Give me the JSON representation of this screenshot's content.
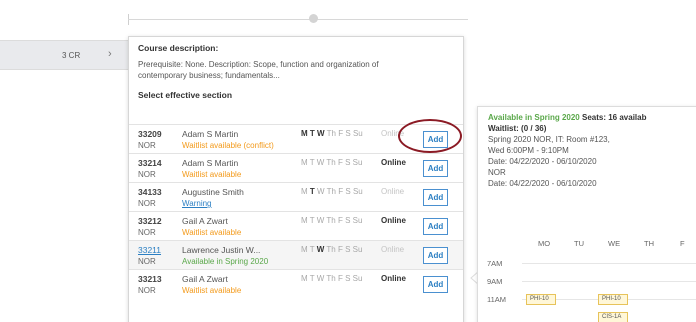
{
  "left_row": {
    "credits": "3 CR",
    "chevron": "›"
  },
  "course": {
    "desc_title": "Course description:",
    "desc_text": "Prerequisite: None. Description: Scope, function and organization of contemporary business; fundamentals...",
    "select_label": "Select effective section"
  },
  "sections": [
    {
      "number": "33209",
      "location": "NOR",
      "instructor": "Adam S Martin",
      "status": "Waitlist available (conflict)",
      "status_color": "#f39a1b",
      "days_active": [
        "M",
        "T",
        "W"
      ],
      "mode": "Online",
      "mode_active": false,
      "add_label": "Add"
    },
    {
      "number": "33214",
      "location": "NOR",
      "instructor": "Adam S Martin",
      "status": "Waitlist available",
      "status_color": "#f39a1b",
      "days_active": [],
      "mode": "Online",
      "mode_active": true,
      "add_label": "Add"
    },
    {
      "number": "34133",
      "location": "NOR",
      "instructor": "Augustine Smith",
      "status": "Warning",
      "status_color": "#2b7fc3",
      "days_active": [
        "T"
      ],
      "mode": "Online",
      "mode_active": false,
      "add_label": "Add"
    },
    {
      "number": "33212",
      "location": "NOR",
      "instructor": "Gail A Zwart",
      "status": "Waitlist available",
      "status_color": "#f39a1b",
      "days_active": [],
      "mode": "Online",
      "mode_active": true,
      "add_label": "Add"
    },
    {
      "number": "33211",
      "location": "NOR",
      "instructor": "Lawrence Justin W...",
      "status": "Available in Spring 2020",
      "status_color": "#5aa84a",
      "days_active": [
        "W"
      ],
      "mode": "Online",
      "mode_active": false,
      "add_label": "Add"
    },
    {
      "number": "33213",
      "location": "NOR",
      "instructor": "Gail A Zwart",
      "status": "Waitlist available",
      "status_color": "#f39a1b",
      "days_active": [],
      "mode": "Online",
      "mode_active": true,
      "add_label": "Add"
    }
  ],
  "day_letters": [
    "M",
    "T",
    "W",
    "Th",
    "F",
    "S",
    "Su"
  ],
  "detail": {
    "available": "Available in Spring 2020",
    "seats": "Seats: 16 availab",
    "waitlist": "Waitlist: (0 / 36)",
    "line1": "Spring 2020 NOR, IT: Room #123,",
    "line2": "Wed 6:00PM - 9:10PM",
    "line3": "Date: 04/22/2020 - 06/10/2020",
    "line4": "NOR",
    "line5": "Date: 04/22/2020 - 06/10/2020"
  },
  "calendar": {
    "days": [
      "MO",
      "TU",
      "WE",
      "TH",
      "F"
    ],
    "times": [
      "7AM",
      "9AM",
      "11AM"
    ],
    "blocks": [
      "PHI-10",
      "PHI-10",
      "PHI-10",
      "CIS-1A"
    ]
  },
  "colors": {
    "accent": "#2b7fc3",
    "waitlist": "#f39a1b",
    "available": "#5aa84a",
    "highlight_circle": "#8b1a24"
  }
}
